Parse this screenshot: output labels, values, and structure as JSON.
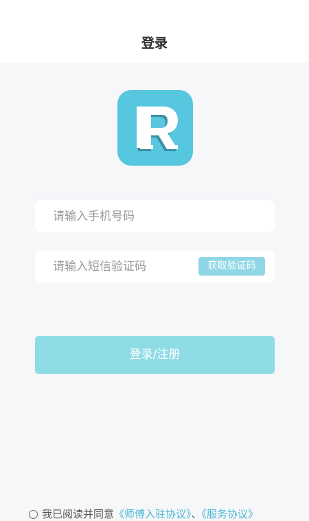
{
  "header": {
    "title": "登录"
  },
  "logo": {
    "icon": "r-logo-icon",
    "color": "#57c6df"
  },
  "phone_field": {
    "placeholder": "请输入手机号码"
  },
  "code_field": {
    "placeholder": "请输入短信验证码",
    "get_code_label": "获取验证码"
  },
  "submit": {
    "label": "登录/注册"
  },
  "agreement": {
    "prefix": "我已阅读并同意",
    "link1": "《师傅入驻协议》",
    "separator": "、",
    "link2": "《服务协议》"
  },
  "colors": {
    "accent": "#57c6df",
    "button": "#8edce6",
    "link": "#4fb8d4",
    "background": "#f5f7f9"
  }
}
